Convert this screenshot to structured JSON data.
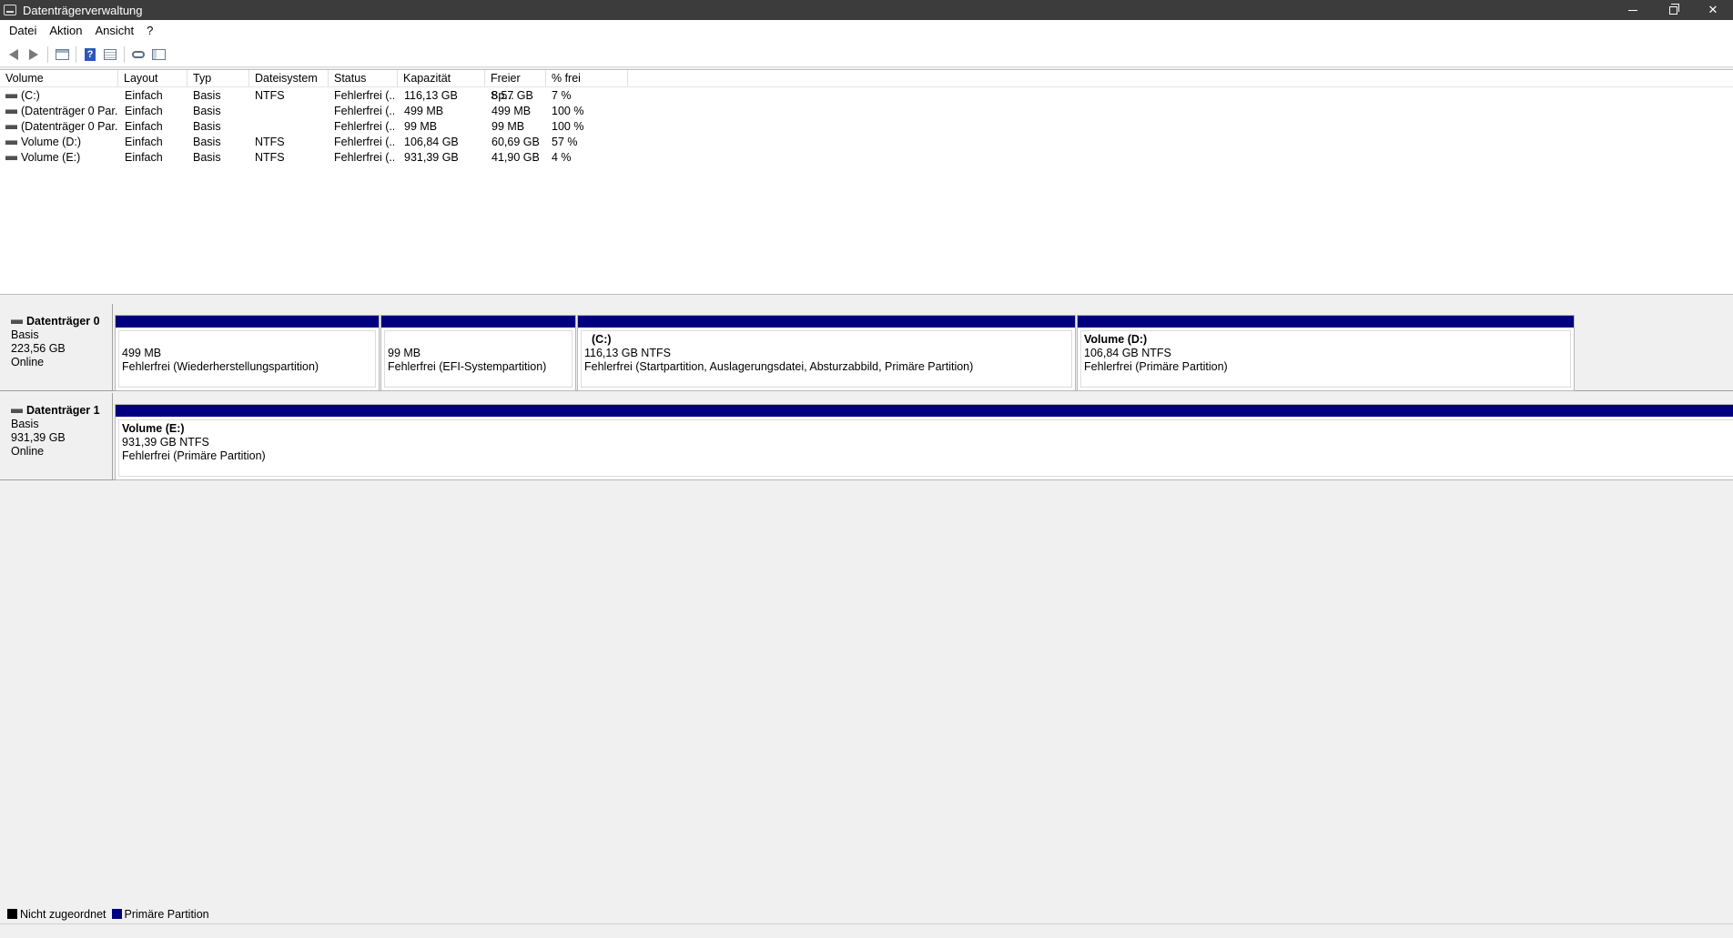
{
  "window": {
    "title": "Datenträgerverwaltung"
  },
  "menu": [
    "Datei",
    "Aktion",
    "Ansicht",
    "?"
  ],
  "toolbar": {
    "icons": [
      "back-icon",
      "forward-icon",
      "panel-icon",
      "help-icon",
      "props-icon",
      "key-icon",
      "list-icon"
    ]
  },
  "columns": [
    "Volume",
    "Layout",
    "Typ",
    "Dateisystem",
    "Status",
    "Kapazität",
    "Freier Sp...",
    "% frei"
  ],
  "volumes": [
    {
      "volume": "(C:)",
      "layout": "Einfach",
      "typ": "Basis",
      "fs": "NTFS",
      "status": "Fehlerfrei (...",
      "kapazitaet": "116,13 GB",
      "frei": "8,57 GB",
      "prozent": "7 %"
    },
    {
      "volume": "(Datenträger 0 Par...",
      "layout": "Einfach",
      "typ": "Basis",
      "fs": "",
      "status": "Fehlerfrei (...",
      "kapazitaet": "499 MB",
      "frei": "499 MB",
      "prozent": "100 %"
    },
    {
      "volume": "(Datenträger 0 Par...",
      "layout": "Einfach",
      "typ": "Basis",
      "fs": "",
      "status": "Fehlerfrei (...",
      "kapazitaet": "99 MB",
      "frei": "99 MB",
      "prozent": "100 %"
    },
    {
      "volume": "Volume (D:)",
      "layout": "Einfach",
      "typ": "Basis",
      "fs": "NTFS",
      "status": "Fehlerfrei (...",
      "kapazitaet": "106,84 GB",
      "frei": "60,69 GB",
      "prozent": "57 %"
    },
    {
      "volume": "Volume (E:)",
      "layout": "Einfach",
      "typ": "Basis",
      "fs": "NTFS",
      "status": "Fehlerfrei (...",
      "kapazitaet": "931,39 GB",
      "frei": "41,90 GB",
      "prozent": "4 %"
    }
  ],
  "disks": [
    {
      "name": "Datenträger 0",
      "type": "Basis",
      "size": "223,56 GB",
      "status": "Online",
      "partitions": [
        {
          "name": "",
          "size": "499 MB",
          "status": "Fehlerfrei (Wiederherstellungspartition)"
        },
        {
          "name": "",
          "size": "99 MB",
          "status": "Fehlerfrei (EFI-Systempartition)"
        },
        {
          "name": "(C:)",
          "size": "116,13 GB NTFS",
          "status": "Fehlerfrei (Startpartition, Auslagerungsdatei, Absturzabbild, Primäre Partition)"
        },
        {
          "name": "Volume  (D:)",
          "size": "106,84 GB NTFS",
          "status": "Fehlerfrei (Primäre Partition)"
        }
      ]
    },
    {
      "name": "Datenträger 1",
      "type": "Basis",
      "size": "931,39 GB",
      "status": "Online",
      "partitions": [
        {
          "name": "Volume  (E:)",
          "size": "931,39 GB NTFS",
          "status": "Fehlerfrei (Primäre Partition)"
        }
      ]
    }
  ],
  "legend": [
    {
      "label": "Nicht zugeordnet",
      "color": "#000000"
    },
    {
      "label": "Primäre Partition",
      "color": "#000080"
    }
  ]
}
